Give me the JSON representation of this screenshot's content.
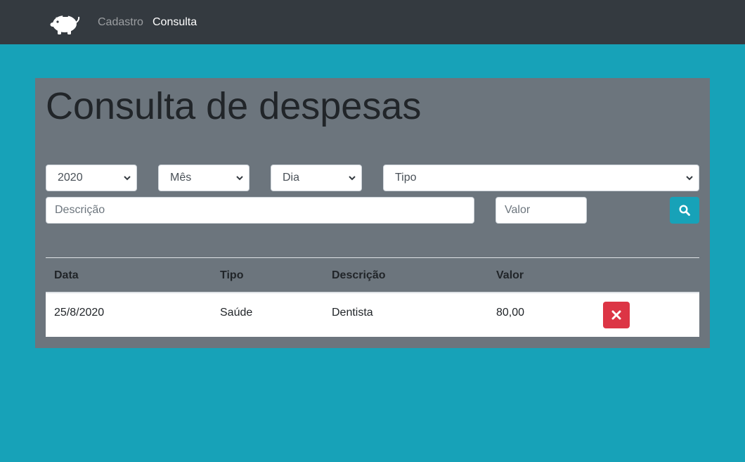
{
  "nav": {
    "logo_icon": "piggy-bank-icon",
    "links": [
      {
        "label": "Cadastro",
        "active": false
      },
      {
        "label": "Consulta",
        "active": true
      }
    ]
  },
  "page": {
    "title": "Consulta de despesas"
  },
  "filters": {
    "ano": {
      "selected": "2020"
    },
    "mes": {
      "selected": "Mês"
    },
    "dia": {
      "selected": "Dia"
    },
    "tipo": {
      "selected": "Tipo"
    },
    "descricao": {
      "value": "",
      "placeholder": "Descrição"
    },
    "valor": {
      "value": "",
      "placeholder": "Valor"
    },
    "search_icon": "search-icon"
  },
  "table": {
    "headers": [
      "Data",
      "Tipo",
      "Descrição",
      "Valor"
    ],
    "rows": [
      {
        "data": "25/8/2020",
        "tipo": "Saúde",
        "descricao": "Dentista",
        "valor": "80,00",
        "action_icon": "close-icon"
      }
    ]
  },
  "colors": {
    "background": "#17a2b8",
    "navbar": "#343a40",
    "card": "#6c757d",
    "search_button": "#17a2b8",
    "delete_button": "#dc3545"
  }
}
